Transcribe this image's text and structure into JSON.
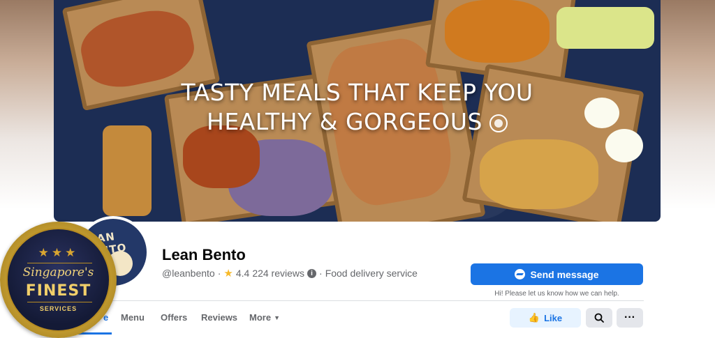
{
  "cover": {
    "headline_line1": "TASTY MEALS THAT KEEP YOU",
    "headline_line2": "HEALTHY & GORGEOUS"
  },
  "page": {
    "name": "Lean Bento",
    "handle": "@leanbento",
    "separator": "·",
    "rating": "4.4",
    "reviews": "224 reviews",
    "category": "Food delivery service"
  },
  "actions": {
    "send_message": "Send message",
    "helper_text": "Hi! Please let us know how we can help.",
    "like": "Like"
  },
  "tabs": [
    {
      "label": "e",
      "active": true
    },
    {
      "label": "Menu"
    },
    {
      "label": "Offers"
    },
    {
      "label": "Reviews"
    },
    {
      "label": "More"
    }
  ],
  "badge": {
    "script": "Singapore's",
    "title": "FINEST",
    "subtitle": "SERVICES",
    "stars": "★★★"
  },
  "colors": {
    "accent": "#1b74e4",
    "cover_bg": "#1c2d54",
    "badge_gold": "#caa235"
  }
}
